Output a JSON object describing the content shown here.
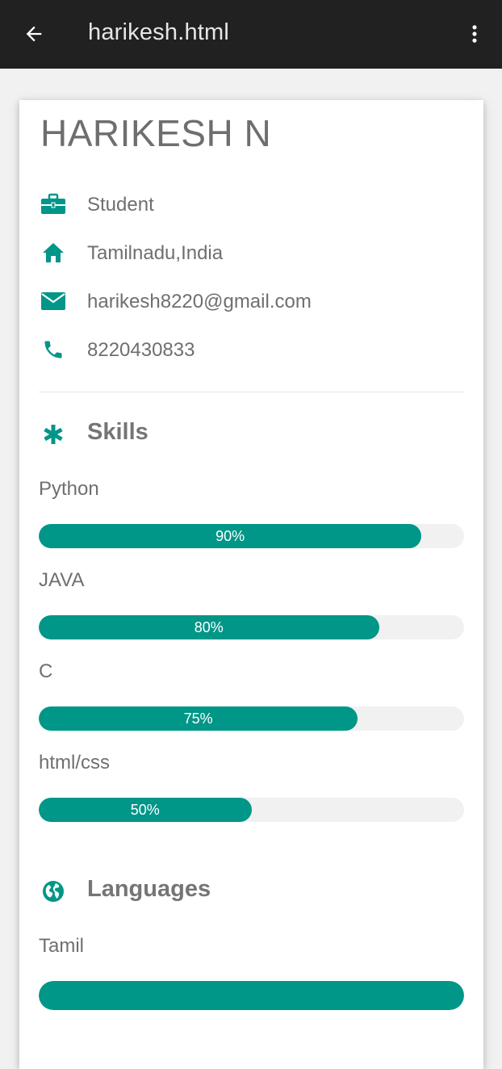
{
  "appbar": {
    "title": "harikesh.html",
    "back_icon": "arrow-left-icon",
    "menu_icon": "more-vertical-icon"
  },
  "profile": {
    "name": "HARIKESH N",
    "info": [
      {
        "icon": "briefcase-icon",
        "text": "Student"
      },
      {
        "icon": "home-icon",
        "text": "Tamilnadu,India"
      },
      {
        "icon": "envelope-icon",
        "text": "harikesh8220@gmail.com"
      },
      {
        "icon": "phone-icon",
        "text": "8220430833"
      }
    ]
  },
  "skills": {
    "heading": "Skills",
    "icon": "asterisk-icon",
    "items": [
      {
        "label": "Python",
        "percent": 90,
        "percent_text": "90%"
      },
      {
        "label": "JAVA",
        "percent": 80,
        "percent_text": "80%"
      },
      {
        "label": "C",
        "percent": 75,
        "percent_text": "75%"
      },
      {
        "label": "html/css",
        "percent": 50,
        "percent_text": "50%"
      }
    ]
  },
  "languages": {
    "heading": "Languages",
    "icon": "globe-icon",
    "items": [
      {
        "label": "Tamil",
        "percent": 100
      }
    ]
  },
  "colors": {
    "accent": "#009688",
    "appbar_bg": "#212121",
    "page_bg": "#f1f1f1",
    "track_bg": "#f1f1f1"
  }
}
